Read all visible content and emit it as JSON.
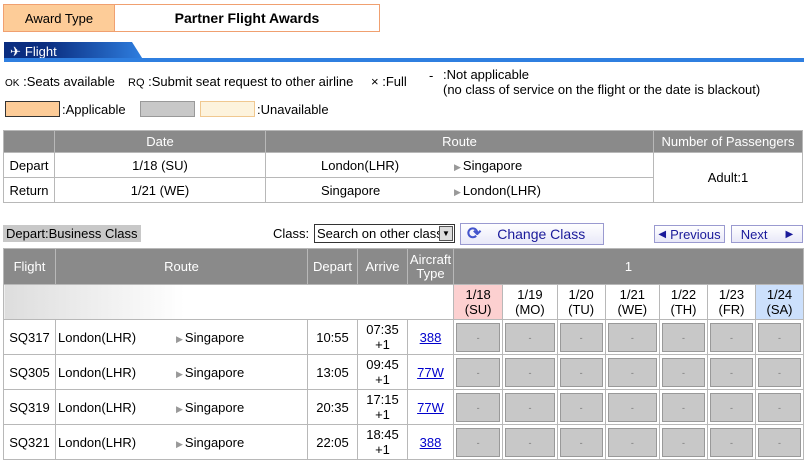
{
  "award": {
    "label": "Award Type",
    "value": "Partner Flight Awards"
  },
  "tab": {
    "label": "Flight"
  },
  "legend": {
    "ok_code": "OK",
    "ok": ":Seats available",
    "rq_code": "RQ",
    "rq": ":Submit seat request to other airline",
    "x_code": "×",
    "x": ":Full",
    "na_code": "-",
    "na_line1": ":Not applicable",
    "na_line2": "(no class of service on the flight or the date is blackout)",
    "applicable": ":Applicable",
    "unavailable": ":Unavailable",
    "colors": {
      "applicable": "#fdcc98",
      "unavailable_gray": "#c8c8c8",
      "unavailable_cream": "#fdf3dd"
    }
  },
  "info": {
    "headers": [
      "",
      "Date",
      "Route",
      "Number of Passengers"
    ],
    "rows": [
      {
        "type": "Depart",
        "date": "1/18 (SU)",
        "from": "London(LHR)",
        "to": "Singapore"
      },
      {
        "type": "Return",
        "date": "1/21 (WE)",
        "from": "Singapore",
        "to": "London(LHR)"
      }
    ],
    "passengers": "Adult:1"
  },
  "section": {
    "title": "Depart:Business Class",
    "class_label": "Class:",
    "class_value": "Search on other class",
    "change_class": "Change Class",
    "previous": "Previous",
    "next": "Next"
  },
  "grid": {
    "headers": {
      "flight": "Flight",
      "route": "Route",
      "depart": "Depart",
      "arrive": "Arrive",
      "aircraft": "Aircraft Type",
      "week": "1"
    },
    "days": [
      {
        "date": "1/18",
        "dow": "(SU)",
        "color": "#fcd0d0"
      },
      {
        "date": "1/19",
        "dow": "(MO)",
        "color": "#ffffff"
      },
      {
        "date": "1/20",
        "dow": "(TU)",
        "color": "#ffffff"
      },
      {
        "date": "1/21",
        "dow": "(WE)",
        "color": "#ffffff"
      },
      {
        "date": "1/22",
        "dow": "(TH)",
        "color": "#ffffff"
      },
      {
        "date": "1/23",
        "dow": "(FR)",
        "color": "#ffffff"
      },
      {
        "date": "1/24",
        "dow": "(SA)",
        "color": "#cce0fc"
      }
    ],
    "flights": [
      {
        "flight": "SQ317",
        "from": "London(LHR)",
        "to": "Singapore",
        "depart": "10:55",
        "arrive": "07:35",
        "offset": "+1",
        "aircraft": "388",
        "avail": [
          "-",
          "-",
          "-",
          "-",
          "-",
          "-",
          "-"
        ]
      },
      {
        "flight": "SQ305",
        "from": "London(LHR)",
        "to": "Singapore",
        "depart": "13:05",
        "arrive": "09:45",
        "offset": "+1",
        "aircraft": "77W",
        "avail": [
          "-",
          "-",
          "-",
          "-",
          "-",
          "-",
          "-"
        ]
      },
      {
        "flight": "SQ319",
        "from": "London(LHR)",
        "to": "Singapore",
        "depart": "20:35",
        "arrive": "17:15",
        "offset": "+1",
        "aircraft": "77W",
        "avail": [
          "-",
          "-",
          "-",
          "-",
          "-",
          "-",
          "-"
        ]
      },
      {
        "flight": "SQ321",
        "from": "London(LHR)",
        "to": "Singapore",
        "depart": "22:05",
        "arrive": "18:45",
        "offset": "+1",
        "aircraft": "388",
        "avail": [
          "-",
          "-",
          "-",
          "-",
          "-",
          "-",
          "-"
        ]
      }
    ]
  }
}
